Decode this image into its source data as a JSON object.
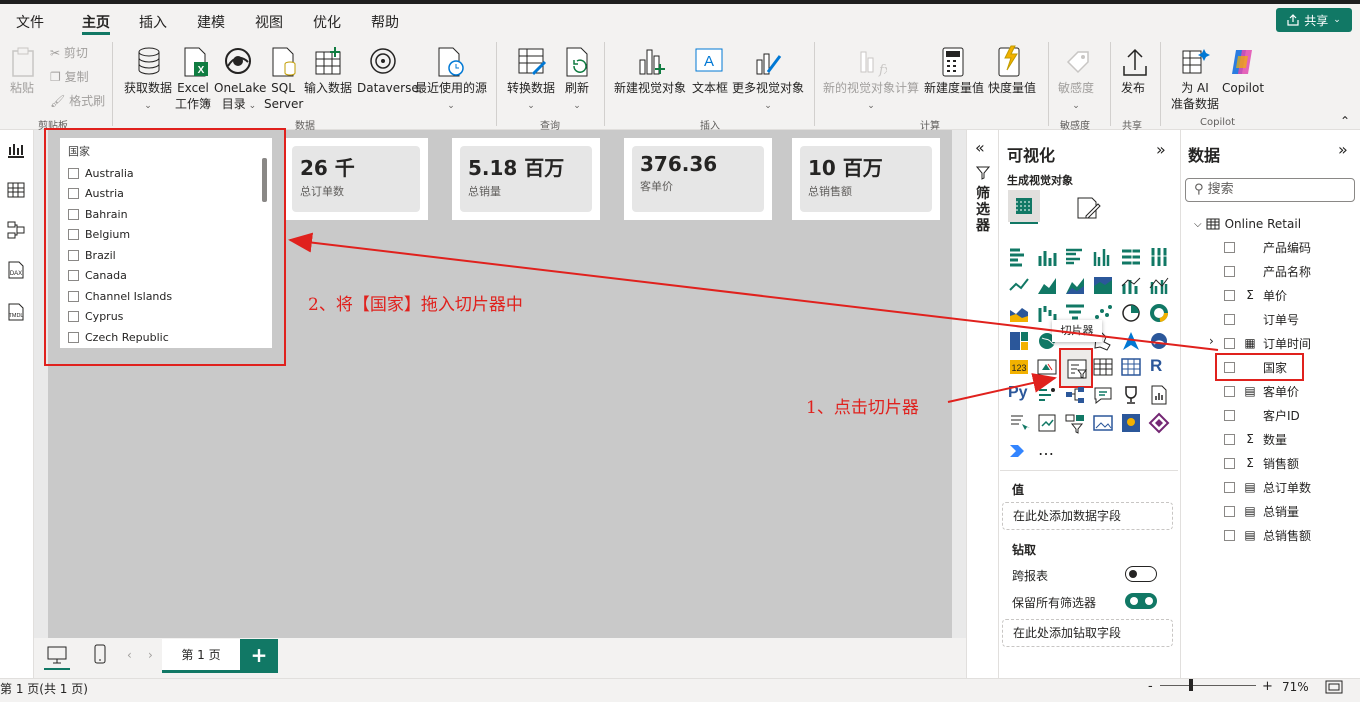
{
  "menu": {
    "items": [
      "文件",
      "主页",
      "插入",
      "建模",
      "视图",
      "优化",
      "帮助"
    ],
    "active": "主页",
    "share_label": "共享"
  },
  "ribbon": {
    "clipboard": {
      "paste": "粘贴",
      "cut": "剪切",
      "copy": "复制",
      "format_painter": "格式刷",
      "group": "剪贴板"
    },
    "data": {
      "get_data": "获取数据",
      "excel_1": "Excel",
      "excel_2": "工作簿",
      "onelake_1": "OneLake",
      "onelake_2": "目录",
      "sql_1": "SQL",
      "sql_2": "Server",
      "enter_data": "输入数据",
      "dataverse": "Dataverse",
      "recent": "最近使用的源",
      "group": "数据"
    },
    "queries": {
      "transform": "转换数据",
      "refresh": "刷新",
      "group": "查询"
    },
    "insert": {
      "new_visual": "新建视觉对象",
      "text_box": "文本框",
      "more_visuals": "更多视觉对象",
      "group": "插入"
    },
    "calculations": {
      "new_visual_calc": "新的视觉对象计算",
      "new_measure": "新建度量值",
      "quick_measure": "快度量值",
      "group": "计算"
    },
    "sensitivity": {
      "label": "敏感度",
      "group": "敏感度"
    },
    "share": {
      "publish": "发布",
      "group": "共享"
    },
    "copilot": {
      "ai_1": "为 AI",
      "ai_2": "准备数据",
      "copilot": "Copilot",
      "group": "Copilot"
    }
  },
  "cards": [
    {
      "value": "26 千",
      "label": "总订单数"
    },
    {
      "value": "5.18 百万",
      "label": "总销量"
    },
    {
      "value": "376.36",
      "label": "客单价"
    },
    {
      "value": "10 百万",
      "label": "总销售额"
    }
  ],
  "slicer": {
    "title": "国家",
    "items": [
      "Australia",
      "Austria",
      "Bahrain",
      "Belgium",
      "Brazil",
      "Canada",
      "Channel Islands",
      "Cyprus",
      "Czech Republic"
    ]
  },
  "page_tabs": {
    "tab1": "第 1 页"
  },
  "status": {
    "page_info": "第 1 页(共 1 页)",
    "zoom": "71%"
  },
  "filters": {
    "label": "筛选器"
  },
  "viz": {
    "title": "可视化",
    "build_visual": "生成视觉对象",
    "tooltip": "切片器",
    "more": "…",
    "values_label": "值",
    "values_well": "在此处添加数据字段",
    "drill_label": "钻取",
    "cross_report": "跨报表",
    "keep_filters": "保留所有筛选器",
    "drill_well": "在此处添加钻取字段"
  },
  "data_pane": {
    "title": "数据",
    "search_placeholder": "搜索",
    "table": "Online Retail",
    "fields": [
      {
        "name": "产品编码",
        "type": ""
      },
      {
        "name": "产品名称",
        "type": ""
      },
      {
        "name": "单价",
        "type": "Σ"
      },
      {
        "name": "订单号",
        "type": ""
      },
      {
        "name": "订单时间",
        "type": "date"
      },
      {
        "name": "国家",
        "type": ""
      },
      {
        "name": "客单价",
        "type": "measure"
      },
      {
        "name": "客户ID",
        "type": ""
      },
      {
        "name": "数量",
        "type": "Σ"
      },
      {
        "name": "销售额",
        "type": "Σ"
      },
      {
        "name": "总订单数",
        "type": "measure"
      },
      {
        "name": "总销量",
        "type": "measure"
      },
      {
        "name": "总销售额",
        "type": "measure"
      }
    ]
  },
  "annotations": {
    "step1": "1、点击切片器",
    "step2": "2、将【国家】拖入切片器中"
  },
  "colors": {
    "accent": "#117865",
    "annotation": "#e0211d"
  }
}
